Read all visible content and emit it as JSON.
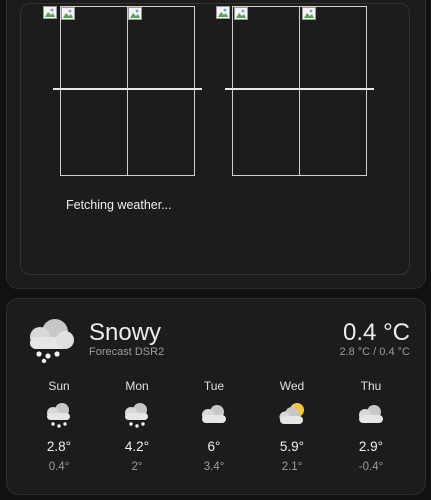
{
  "map": {
    "status_text": "Fetching weather...",
    "tile_icon": "broken-image-icon"
  },
  "weather": {
    "condition": "Snowy",
    "source": "Forecast DSR2",
    "current_temp": "0.4 °C",
    "high_low": "2.8 °C / 0.4 °C",
    "condition_icon": "snowy-icon",
    "forecast": [
      {
        "day": "Sun",
        "high": "2.8°",
        "low": "0.4°",
        "icon": "snowy-icon"
      },
      {
        "day": "Mon",
        "high": "4.2°",
        "low": "2°",
        "icon": "snowy-icon"
      },
      {
        "day": "Tue",
        "high": "6°",
        "low": "3.4°",
        "icon": "cloudy-icon"
      },
      {
        "day": "Wed",
        "high": "5.9°",
        "low": "2.1°",
        "icon": "partly-cloudy-icon"
      },
      {
        "day": "Thu",
        "high": "2.9°",
        "low": "-0.4°",
        "icon": "cloudy-icon"
      }
    ]
  }
}
